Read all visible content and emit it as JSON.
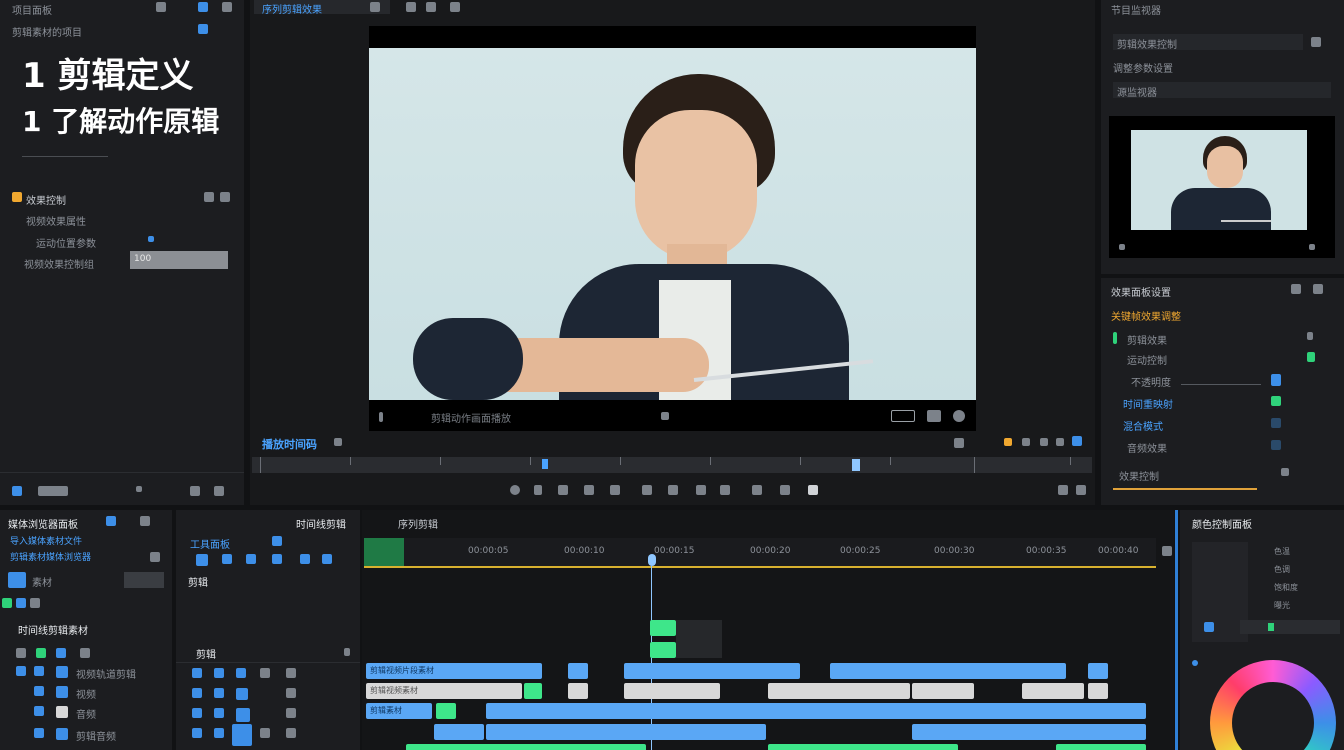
{
  "overlay": {
    "line1": "1 剪辑定义",
    "line2": "1 了解动作原辑"
  },
  "project_panel": {
    "title": "项目面板",
    "subtitle": "剪辑素材的项目",
    "section_title": "效果控制",
    "rows": [
      "视频效果属性",
      "运动位置参数",
      "视频效果控制组"
    ],
    "selected_value": "100"
  },
  "source_tab": {
    "label": "序列剪辑效果"
  },
  "viewer": {
    "caption": "剪辑动作画面播放",
    "timecode": "播放时间码"
  },
  "program_monitor": {
    "title": "节目监视器",
    "field1": "剪辑效果控制",
    "field2": "调整参数设置",
    "caption_row": "源监视器"
  },
  "effects_panel": {
    "title": "效果面板设置",
    "highlight": "关键帧效果调整",
    "rows": [
      "剪辑效果",
      "运动控制",
      "不透明度",
      "时间重映射",
      "混合模式",
      "音频效果"
    ],
    "footer": "效果控制"
  },
  "media_browser": {
    "title": "媒体浏览器面板",
    "subtitle": "导入媒体素材文件",
    "link": "剪辑素材媒体浏览器",
    "item": "素材",
    "list_title": "时间线剪辑素材"
  },
  "tools": {
    "title": "工具面板",
    "label": "剪辑"
  },
  "track_headers": {
    "group_title": "剪辑",
    "tracks": [
      "视频轨道剪辑",
      "视频",
      "音频",
      "剪辑音频"
    ]
  },
  "timeline": {
    "title": "时间线剪辑",
    "sequence": "序列剪辑",
    "ruler": [
      "00:00:05",
      "00:00:10",
      "00:00:15",
      "00:00:20",
      "00:00:25",
      "00:00:30",
      "00:00:35",
      "00:00:40"
    ],
    "clip_labels": [
      "剪辑视频片段素材",
      "剪辑视频素材",
      "剪辑素材"
    ]
  },
  "lumetri": {
    "title": "颜色控制面板",
    "rows": [
      "色温",
      "色调",
      "饱和度",
      "曝光"
    ]
  },
  "colors": {
    "accent_blue": "#4aa3ff",
    "clip_blue": "#5aa7f5",
    "clip_green": "#3ee68a",
    "playhead": "#8fc7ff"
  }
}
